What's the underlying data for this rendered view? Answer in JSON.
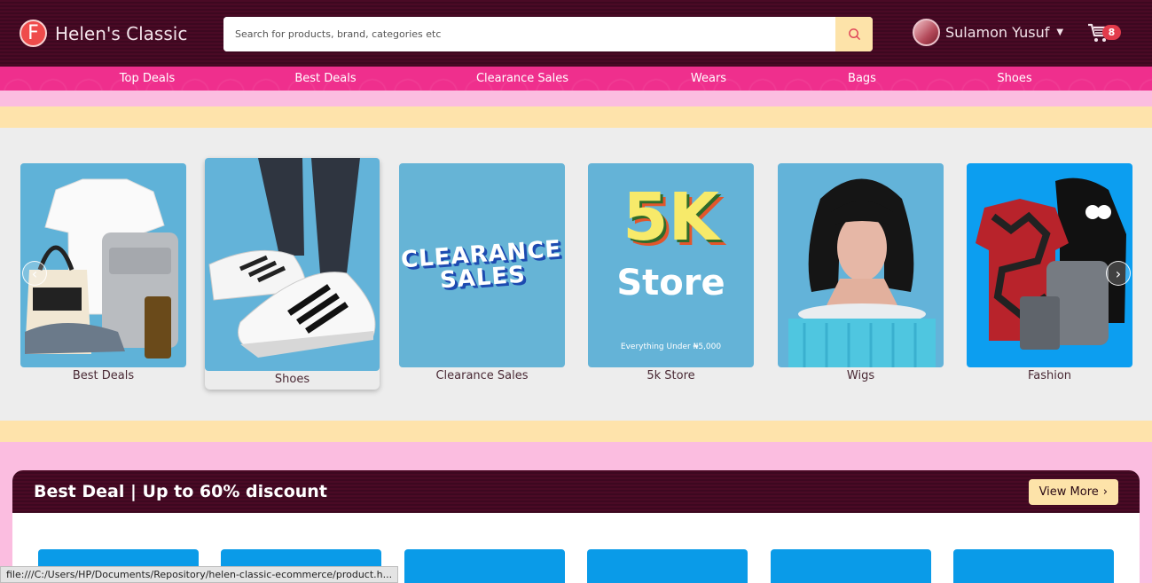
{
  "header": {
    "logo_letter": "F",
    "brand": "Helen's Classic",
    "search_placeholder": "Search for products, brand, categories etc",
    "user_name": "Sulamon Yusuf",
    "cart_count": "8"
  },
  "nav": {
    "items": [
      "Top Deals",
      "Best Deals",
      "Clearance Sales",
      "Wears",
      "Bags",
      "Shoes"
    ]
  },
  "categories": [
    {
      "label": "Best Deals",
      "image": "bags-clothes"
    },
    {
      "label": "Shoes",
      "image": "sneakers"
    },
    {
      "label": "Clearance Sales",
      "image": "clearance-banner",
      "banner_line1": "CLEARANCE",
      "banner_line2": "SALES"
    },
    {
      "label": "5k Store",
      "image": "5k-banner",
      "banner_big": "5K",
      "banner_store": "Store",
      "banner_sub": "Everything Under ₦5,000"
    },
    {
      "label": "Wigs",
      "image": "wig"
    },
    {
      "label": "Fashion",
      "image": "shirts-hoodie"
    }
  ],
  "deal": {
    "title": "Best Deal | Up to 60% discount",
    "view_more": "View More"
  },
  "statusbar": "file:///C:/Users/HP/Documents/Repository/helen-classic-ecommerce/product.h...",
  "colors": {
    "header_bg": "#4a0a25",
    "nav_bg": "#ef2f8d",
    "accent_yellow": "#fee3ab",
    "page_pink": "#fbbde0",
    "card_blue": "#5fb2d8"
  }
}
